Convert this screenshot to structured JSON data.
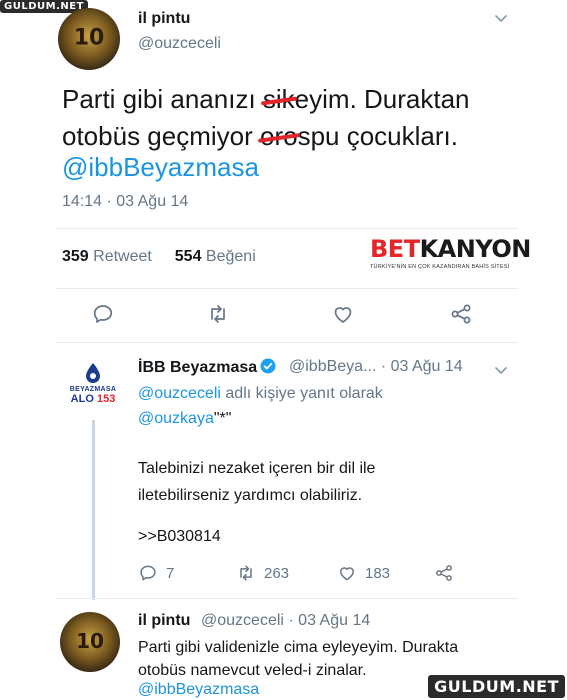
{
  "watermark": {
    "top": "GULDUM.NET",
    "bottom": "GULDUM.NET"
  },
  "tweet": {
    "author_name": "il pintu",
    "author_handle": "@ouzceceli",
    "avatar_number": "10",
    "text_line1_a": "Parti gibi ananızı ",
    "text_line1_strike": "sik",
    "text_line1_b": "eyim. Duraktan",
    "text_line2_a": "otobüs geçmiyor ",
    "text_line2_strike": "oro",
    "text_line2_b": "spu çocukları.",
    "mention": "@ibbBeyazmasa",
    "timestamp": "14:14 · 03 Ağu 14",
    "retweet_count": "359",
    "retweet_label": "Retweet",
    "like_count": "554",
    "like_label": "Beğeni",
    "icons": [
      "reply-icon",
      "retweet-icon",
      "heart-icon",
      "share-icon",
      "chevron-down-icon"
    ]
  },
  "ad": {
    "brand_part1": "BET",
    "brand_part2": "KANYON",
    "tagline": "TÜRKİYE'NİN EN ÇOK KAZANDIRAN BAHİS SİTESİ"
  },
  "reply": {
    "logo_line1": "BEYAZMASA",
    "logo_line2": "ALO",
    "logo_number": "153",
    "author_name": "İBB Beyazmasa",
    "author_handle_date": "@ibbBeya... · 03 Ağu 14",
    "reply_to_mention": "@ouzceceli",
    "reply_to_text": " adlı kişiye yanıt olarak",
    "second_mention": "@ouzkaya",
    "second_suffix": "\"*\"",
    "body_line1": "Talebinizi nezaket içeren bir dil ile",
    "body_line2": "iletebilirseniz yardımcı olabiliriz.",
    "code": ">>B030814",
    "reply_count": "7",
    "retweet_count": "263",
    "like_count": "183"
  },
  "third": {
    "author_name": "il pintu",
    "author_meta": "@ouzceceli · 03 Ağu 14",
    "body_line1": "Parti gibi validenizle cima eyleyeyim. Durakta",
    "body_line2": "otobüs namevcut veled-i zinalar.",
    "mention": "@ibbBeyazmasa",
    "avatar_number": "10"
  },
  "colors": {
    "link": "#1b95e0",
    "muted": "#657786",
    "text": "#14171a",
    "brand_red": "#e2262a",
    "verified": "#1da1f2"
  }
}
